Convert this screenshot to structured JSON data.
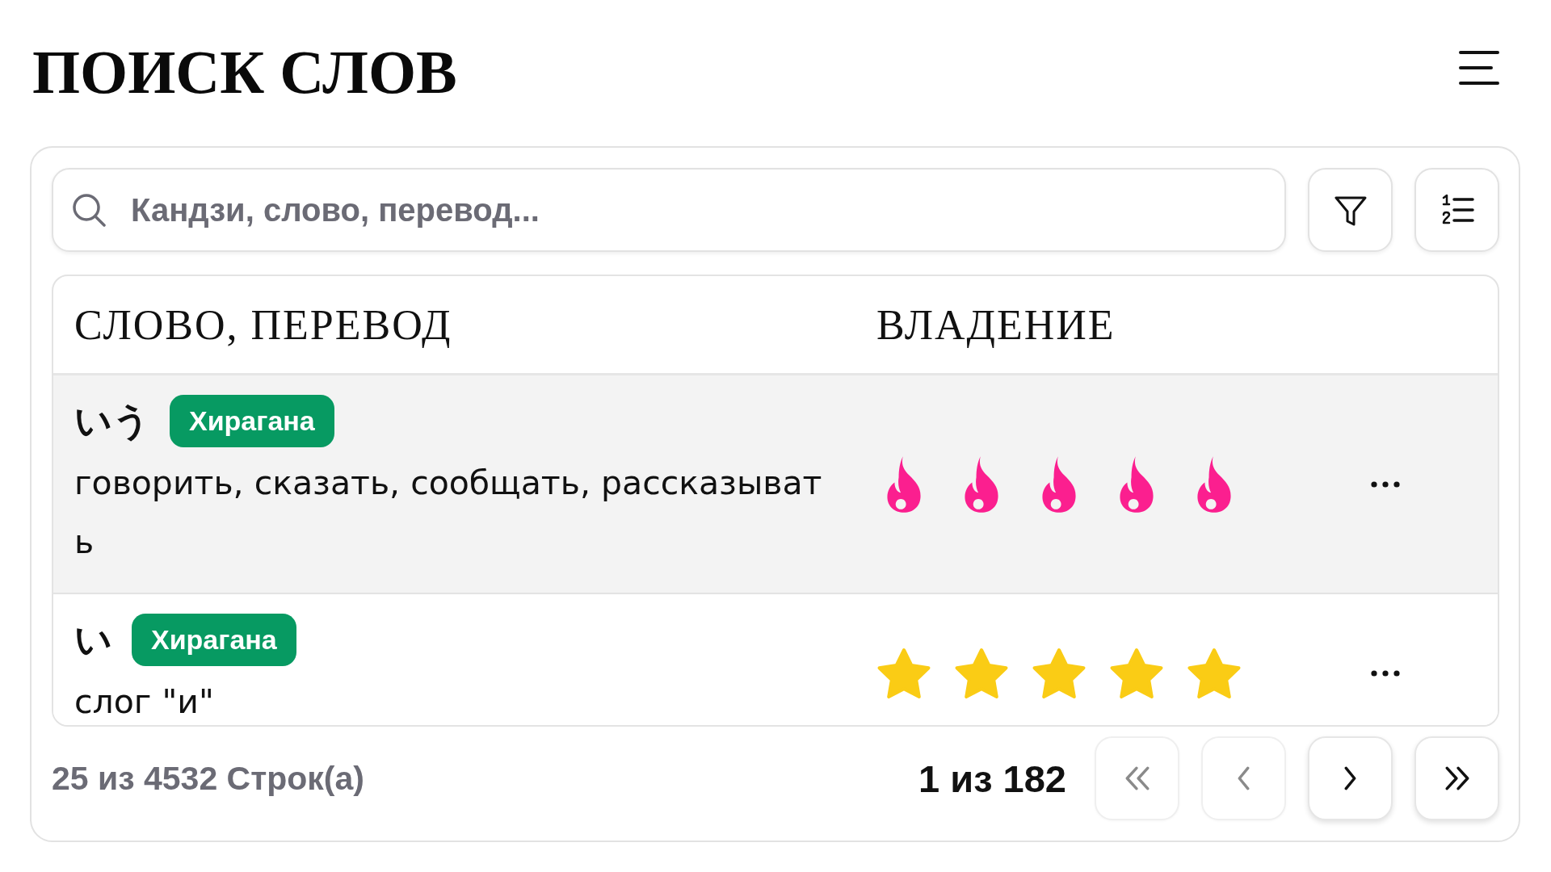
{
  "page": {
    "title": "ПОИСК СЛОВ"
  },
  "search": {
    "placeholder": "Кандзи, слово, перевод..."
  },
  "table": {
    "columns": [
      "СЛОВО, ПЕРЕВОД",
      "ВЛАДЕНИЕ"
    ],
    "rows": [
      {
        "word": "いう",
        "tag": "Хирагана",
        "translation": "говорить, сказать, сообщать, рассказывать",
        "selected": true,
        "mastery": {
          "kind": "flame",
          "stars": 5
        }
      },
      {
        "word": "い",
        "tag": "Хирагана",
        "translation": "слог \"и\"",
        "selected": false,
        "mastery": {
          "kind": "star",
          "stars": 5
        }
      }
    ]
  },
  "footer": {
    "rows_info": "25 из 4532 Строк(а)",
    "page_info": "1 из 182",
    "pager": [
      {
        "kind": "first",
        "disabled": true
      },
      {
        "kind": "previous",
        "disabled": true
      },
      {
        "kind": "next",
        "disabled": false
      },
      {
        "kind": "last",
        "disabled": false
      }
    ]
  }
}
